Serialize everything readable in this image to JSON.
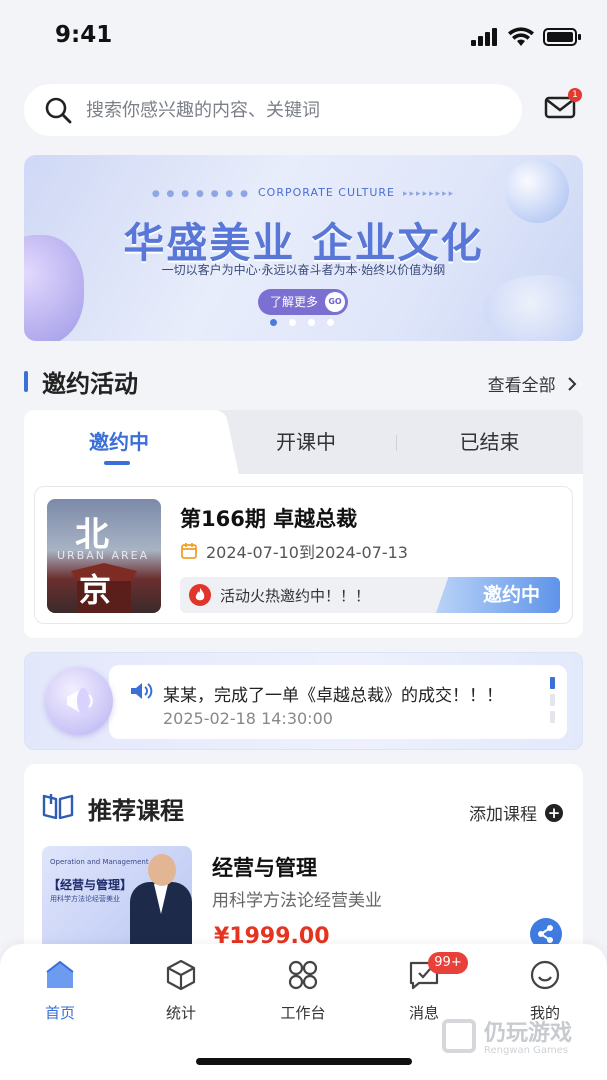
{
  "status_bar": {
    "time": "9:41"
  },
  "search": {
    "placeholder": "搜索你感兴趣的内容、关键词",
    "mail_badge": "1"
  },
  "banner": {
    "sub_en": "CORPORATE CULTURE",
    "title": "华盛美业 企业文化",
    "slogan": "一切以客户为中心·永远以奋斗者为本·始终以价值为纲",
    "button_label": "了解更多",
    "button_go": "GO",
    "page_count": 4,
    "active_page": 1
  },
  "invite_section": {
    "title": "邀约活动",
    "more_label": "查看全部"
  },
  "invite_tabs": [
    {
      "label": "邀约中",
      "active": true
    },
    {
      "label": "开课中",
      "active": false
    },
    {
      "label": "已结束",
      "active": false
    }
  ],
  "invite_item": {
    "thumb_text_1": "北",
    "thumb_text_2": "京",
    "thumb_en": "URBAN AREA",
    "title": "第166期 卓越总裁",
    "date_range": "2024-07-10到2024-07-13",
    "hot_text": "活动火热邀约中！！！",
    "status_label": "邀约中"
  },
  "notice": {
    "text": "某某，完成了一单《卓越总裁》的成交！！！",
    "time": "2025-02-18 14:30:00"
  },
  "recommend": {
    "title": "推荐课程",
    "add_label": "添加课程",
    "course": {
      "thumb_en": "Operation and Management",
      "thumb_title": "【经营与管理】",
      "thumb_sub": "用科学方法论经营美业",
      "name": "经营与管理",
      "desc": "用科学方法论经营美业",
      "price": "¥1999.00"
    }
  },
  "tabbar": {
    "items": [
      {
        "label": "首页",
        "icon": "home-icon",
        "active": true
      },
      {
        "label": "统计",
        "icon": "cube-icon",
        "active": false
      },
      {
        "label": "工作台",
        "icon": "grid-icon",
        "active": false
      },
      {
        "label": "消息",
        "icon": "message-icon",
        "active": false,
        "badge": "99+"
      },
      {
        "label": "我的",
        "icon": "smile-icon",
        "active": false
      }
    ]
  },
  "watermark": {
    "cn": "仍玩游戏",
    "en": "Rengwan Games"
  },
  "colors": {
    "accent": "#3a6fd8",
    "price": "#e5341f",
    "badge": "#e8413a"
  }
}
